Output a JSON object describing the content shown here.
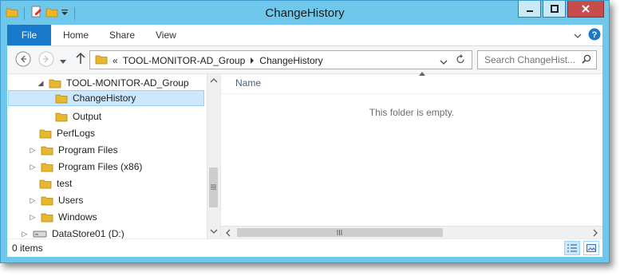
{
  "window": {
    "title": "ChangeHistory"
  },
  "ribbon": {
    "tabs": [
      "File",
      "Home",
      "Share",
      "View"
    ]
  },
  "address": {
    "breadcrumb": [
      "«",
      "TOOL-MONITOR-AD_Group",
      "ChangeHistory"
    ]
  },
  "search": {
    "placeholder": "Search ChangeHist..."
  },
  "tree": {
    "items": [
      {
        "label": "TOOL-MONITOR-AD_Group"
      },
      {
        "label": "ChangeHistory"
      },
      {
        "label": "Output"
      },
      {
        "label": "PerfLogs"
      },
      {
        "label": "Program Files"
      },
      {
        "label": "Program Files (x86)"
      },
      {
        "label": "test"
      },
      {
        "label": "Users"
      },
      {
        "label": "Windows"
      },
      {
        "label": "DataStore01 (D:)"
      }
    ]
  },
  "content": {
    "column_name": "Name",
    "empty_message": "This folder is empty."
  },
  "status": {
    "item_count": "0 items"
  },
  "colors": {
    "accent": "#1979ca",
    "titlebar": "#6fc8ec",
    "selection": "#cce8ff",
    "folder": "#e8b730"
  }
}
